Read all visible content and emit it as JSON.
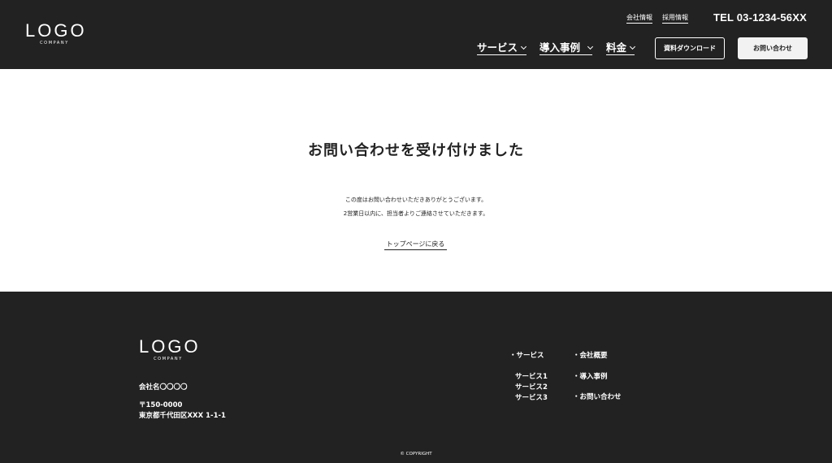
{
  "header": {
    "logo_main": "LOGO",
    "logo_sub": "COMPANY",
    "top_links": [
      "会社情報",
      "採用情報"
    ],
    "tel": "TEL 03-1234-56XX",
    "nav": [
      "サービス",
      "導入事例",
      "料金"
    ],
    "download_label": "資料ダウンロード",
    "contact_label": "お問い合わせ"
  },
  "main": {
    "title": "お問い合わせを受け付けました",
    "message_line1": "この度はお問い合わせいただきありがとうございます。",
    "message_line2": "2営業日以内に、担当者よりご連絡させていただきます。",
    "back_link": "トップページに戻る"
  },
  "footer": {
    "logo_main": "LOGO",
    "logo_sub": "COMPANY",
    "company_name": "会社名〇〇〇〇",
    "postal_code": "〒150-0000",
    "address": "東京都千代田区XXX 1-1-1",
    "nav_service": "・サービス",
    "nav_service_items": [
      "サービス1",
      "サービス2",
      "サービス3"
    ],
    "nav_company": "・会社概要",
    "nav_cases": "・導入事例",
    "nav_contact": "・お問い合わせ",
    "copyright": "© COPYRIGHT"
  },
  "colors": {
    "dark_background": "#222222",
    "light_background": "#ffffff",
    "contact_button_bg": "#f2f2f2"
  }
}
